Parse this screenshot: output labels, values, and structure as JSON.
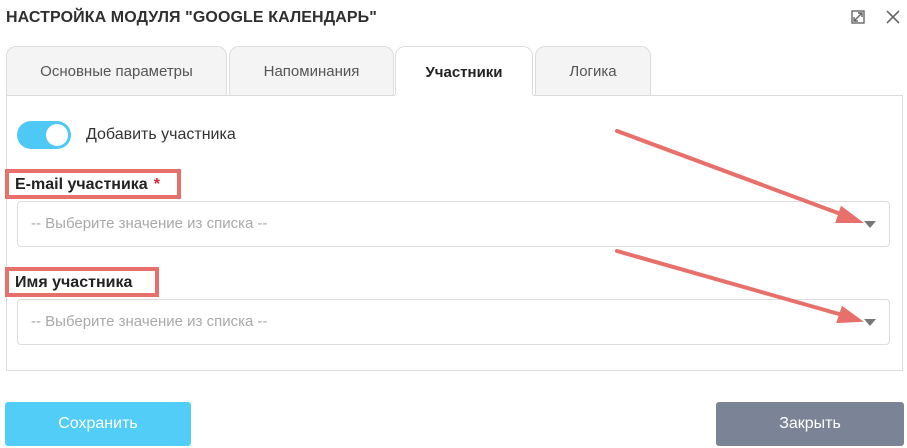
{
  "dialog": {
    "title": "НАСТРОЙКА МОДУЛЯ \"GOOGLE КАЛЕНДАРЬ\"",
    "icons": {
      "expand": "expand-icon",
      "close": "close-icon"
    }
  },
  "tabs": [
    {
      "label": "Основные параметры",
      "active": false
    },
    {
      "label": "Напоминания",
      "active": false
    },
    {
      "label": "Участники",
      "active": true
    },
    {
      "label": "Логика",
      "active": false
    }
  ],
  "participants": {
    "toggle_label": "Добавить участника",
    "toggle_on": true,
    "email": {
      "label": "E-mail участника",
      "required_mark": "*",
      "placeholder": "-- Выберите значение из списка --"
    },
    "name": {
      "label": "Имя участника",
      "placeholder": "-- Выберите значение из списка --"
    }
  },
  "buttons": {
    "save": "Сохранить",
    "close": "Закрыть"
  },
  "colors": {
    "accent": "#4ec9f5",
    "save_button": "#52cdf8",
    "close_button": "#7b8497",
    "highlight": "#e8706a",
    "required": "#d9232e"
  }
}
